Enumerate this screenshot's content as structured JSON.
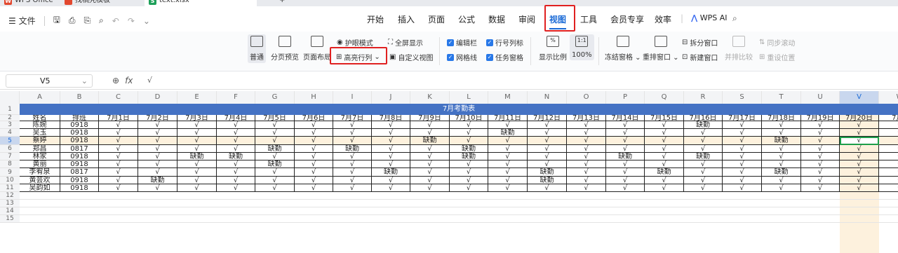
{
  "titlebar": {
    "app": "WPS Office",
    "tab2": "找稿壳模板",
    "file": "text.xlsx",
    "add": "+"
  },
  "menubar": {
    "file": "文件",
    "tabs": [
      "开始",
      "插入",
      "页面",
      "公式",
      "数据",
      "审阅",
      "视图",
      "工具",
      "会员专享",
      "效率"
    ],
    "selected": "视图",
    "wps_ai": "WPS AI"
  },
  "ribbon": {
    "normal": "普通",
    "page_break": "分页预览",
    "page_layout": "页面布局",
    "eye_mode": "护眼模式",
    "highlight": "高亮行列",
    "fullscreen": "全屏显示",
    "custom_view": "自定义视图",
    "edit_bar": "编辑栏",
    "gridlines": "网格线",
    "rowcol_label": "行号列标",
    "task_pane": "任务窗格",
    "zoom": "显示比例",
    "zoom100": "100%",
    "freeze": "冻结窗格",
    "arrange": "重排窗口",
    "split": "拆分窗口",
    "new_window": "新建窗口",
    "side_by_side": "并排比较",
    "sync_scroll": "同步滚动",
    "reset_pos": "重设位置"
  },
  "formula": {
    "cell_ref": "V5",
    "value": "√"
  },
  "accent": "#4472c4",
  "sheet": {
    "columns": [
      "A",
      "B",
      "C",
      "D",
      "E",
      "F",
      "G",
      "H",
      "I",
      "J",
      "K",
      "L",
      "M",
      "N",
      "O",
      "P",
      "Q",
      "R",
      "S",
      "T",
      "U",
      "V",
      "W"
    ],
    "title": "7月考勤表",
    "header": [
      "姓名",
      "排班",
      "7月1日",
      "7月2日",
      "7月3日",
      "7月4日",
      "7月5日",
      "7月6日",
      "7月7日",
      "7月8日",
      "7月9日",
      "7月10日",
      "7月11日",
      "7月12日",
      "7月13日",
      "7月14日",
      "7月15日",
      "7月16日",
      "7月17日",
      "7月18日",
      "7月19日",
      "7月20日",
      "7月2"
    ],
    "rows": [
      [
        "陈婉",
        "0918",
        "√",
        "√",
        "√",
        "√",
        "√",
        "√",
        "√",
        "√",
        "√",
        "√",
        "√",
        "√",
        "√",
        "√",
        "√",
        "缺勤",
        "√",
        "√",
        "√",
        "√",
        "√"
      ],
      [
        "吴玉",
        "0918",
        "√",
        "√",
        "√",
        "√",
        "√",
        "√",
        "√",
        "√",
        "√",
        "√",
        "缺勤",
        "√",
        "√",
        "√",
        "√",
        "√",
        "√",
        "√",
        "√",
        "√",
        "√"
      ],
      [
        "蔡婷",
        "0918",
        "√",
        "√",
        "√",
        "√",
        "√",
        "√",
        "√",
        "√",
        "缺勤",
        "√",
        "√",
        "√",
        "√",
        "√",
        "√",
        "√",
        "√",
        "缺勤",
        "√",
        "√",
        "√"
      ],
      [
        "郑昌",
        "0817",
        "√",
        "√",
        "√",
        "√",
        "缺勤",
        "√",
        "缺勤",
        "√",
        "√",
        "缺勤",
        "√",
        "√",
        "√",
        "√",
        "√",
        "√",
        "√",
        "√",
        "√",
        "√",
        "√"
      ],
      [
        "林家",
        "0918",
        "√",
        "√",
        "缺勤",
        "缺勤",
        "√",
        "√",
        "√",
        "√",
        "√",
        "缺勤",
        "√",
        "√",
        "√",
        "缺勤",
        "√",
        "缺勤",
        "√",
        "√",
        "√",
        "√",
        "√"
      ],
      [
        "黄丽",
        "0918",
        "√",
        "√",
        "√",
        "√",
        "缺勤",
        "√",
        "√",
        "√",
        "√",
        "√",
        "√",
        "√",
        "√",
        "√",
        "√",
        "√",
        "√",
        "√",
        "√",
        "√",
        "√"
      ],
      [
        "李宥泉",
        "0817",
        "√",
        "√",
        "√",
        "√",
        "√",
        "√",
        "√",
        "缺勤",
        "√",
        "√",
        "√",
        "缺勤",
        "√",
        "√",
        "缺勤",
        "√",
        "√",
        "缺勤",
        "√",
        "√",
        "√"
      ],
      [
        "黄芸欢",
        "0918",
        "√",
        "缺勤",
        "√",
        "√",
        "√",
        "√",
        "√",
        "√",
        "√",
        "√",
        "√",
        "缺勤",
        "√",
        "√",
        "√",
        "√",
        "√",
        "√",
        "√",
        "√",
        "√"
      ],
      [
        "吴韵如",
        "0918",
        "√",
        "√",
        "√",
        "√",
        "√",
        "√",
        "√",
        "√",
        "√",
        "√",
        "√",
        "√",
        "√",
        "√",
        "√",
        "√",
        "√",
        "√",
        "√",
        "√",
        "√"
      ]
    ],
    "row_numbers": [
      "1",
      "2",
      "3",
      "4",
      "5",
      "6",
      "7",
      "8",
      "9",
      "10",
      "11",
      "12",
      "13",
      "14",
      "15"
    ]
  }
}
